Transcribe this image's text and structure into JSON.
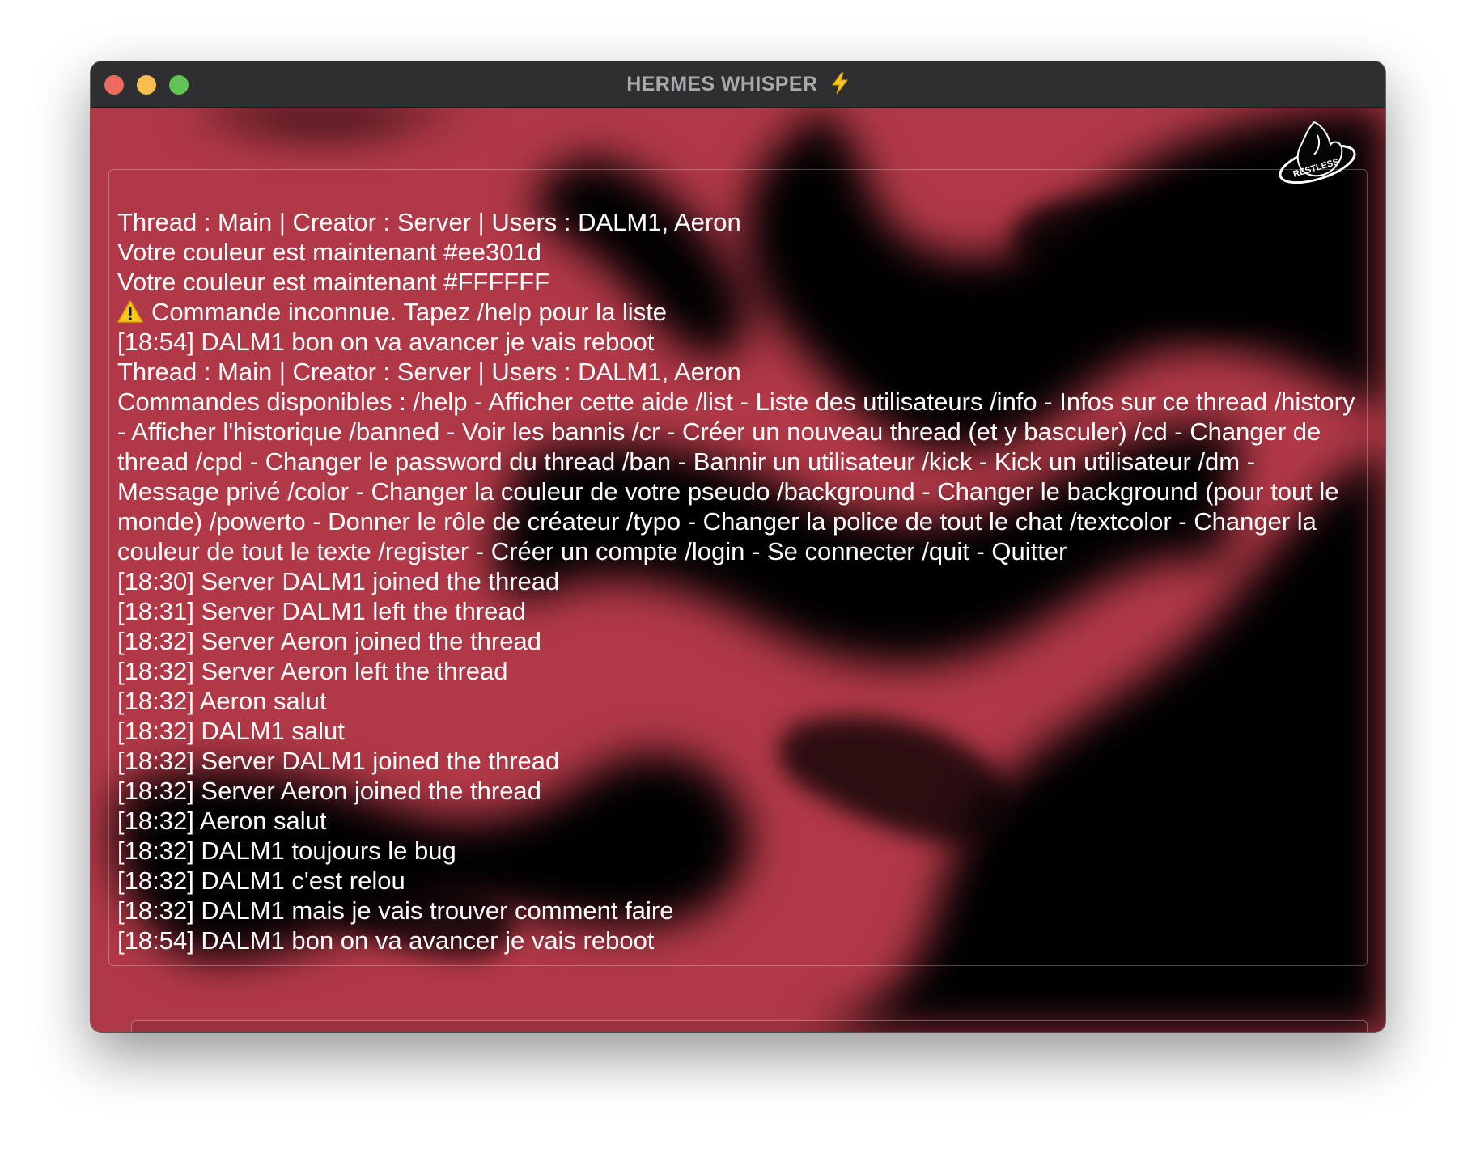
{
  "window": {
    "title": "HERMES WHISPER",
    "title_icon": "lightning-bolt-icon"
  },
  "logo": {
    "name": "restless-logo",
    "text": "RESTLESS"
  },
  "colors": {
    "background_red": "#b23a48",
    "background_dark": "#000000",
    "text": "#ffffff",
    "prompt": "#4fd04f",
    "titlebar": "#2f2f32"
  },
  "messages": [
    "Thread : Main | Creator : Server | Users : DALM1, Aeron",
    "Votre couleur est maintenant #ee301d",
    "Votre couleur est maintenant #FFFFFF",
    "Commande inconnue. Tapez /help pour la liste",
    "[18:54] DALM1 bon on va avancer je vais reboot",
    "Thread : Main | Creator : Server | Users : DALM1, Aeron",
    "Commandes disponibles : /help - Afficher cette aide /list - Liste des utilisateurs /info - Infos sur ce thread /history - Afficher l'historique /banned - Voir les bannis /cr - Créer un nouveau thread (et y basculer) /cd - Changer de thread /cpd - Changer le password du thread /ban - Bannir un utilisateur /kick - Kick un utilisateur /dm - Message privé /color - Changer la couleur de votre pseudo /background - Changer le background (pour tout le monde) /powerto - Donner le rôle de créateur /typo - Changer la police de tout le chat /textcolor - Changer la couleur de tout le texte /register - Créer un compte /login - Se connecter /quit - Quitter",
    "[18:30] Server DALM1 joined the thread",
    "[18:31] Server DALM1 left the thread",
    "[18:32] Server Aeron joined the thread",
    "[18:32] Server Aeron left the thread",
    "[18:32] Aeron salut",
    "[18:32] DALM1 salut",
    "[18:32] Server DALM1 joined the thread",
    "[18:32] Server Aeron joined the thread",
    "[18:32] Aeron salut",
    "[18:32] DALM1 toujours le bug",
    "[18:32] DALM1 c'est relou",
    "[18:32] DALM1 mais je vais trouver comment faire",
    "[18:54] DALM1 bon on va avancer je vais reboot"
  ],
  "warning_icon": "warning-triangle-icon",
  "input": {
    "prompt_symbol": ">",
    "value": "",
    "placeholder": ""
  }
}
